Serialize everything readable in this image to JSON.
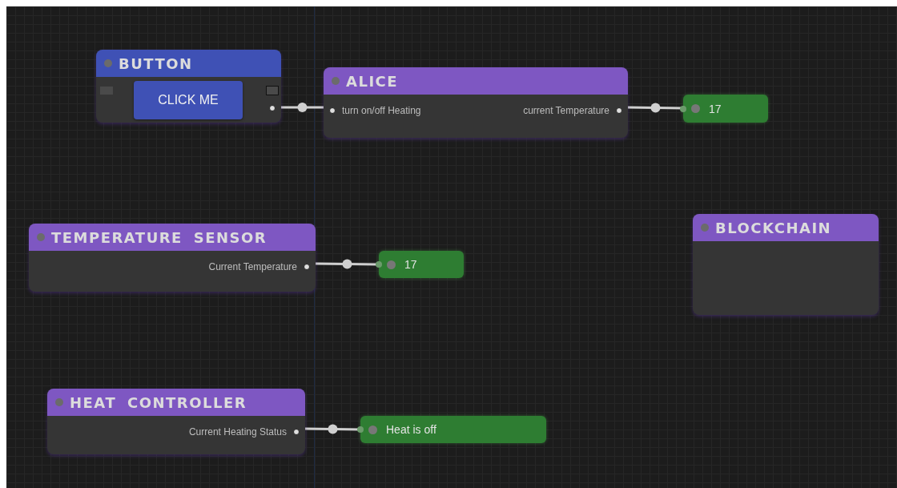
{
  "canvas": {
    "nodes": [
      {
        "kind": "button",
        "title": "BUTTON",
        "color": "#3f51b5",
        "button_label": "CLICK ME",
        "output_connected": true
      },
      {
        "kind": "node",
        "title": "ALICE",
        "color": "#7e57c2",
        "inputs": [
          "turn on/off Heating"
        ],
        "outputs": [
          {
            "label": "current Temperature",
            "connected": true
          }
        ]
      },
      {
        "kind": "display",
        "value": "17"
      },
      {
        "kind": "node",
        "title": "TEMPERATURE SENSOR",
        "color": "#7e57c2",
        "outputs": [
          {
            "label": "Current Temperature",
            "connected": true
          }
        ]
      },
      {
        "kind": "display",
        "value": "17"
      },
      {
        "kind": "node",
        "title": "BLOCKCHAIN",
        "color": "#7e57c2"
      },
      {
        "kind": "node",
        "title": "HEAT CONTROLLER",
        "color": "#7e57c2",
        "outputs": [
          {
            "label": "Current Heating Status",
            "connected": true
          }
        ]
      },
      {
        "kind": "display",
        "value": "Heat is off"
      }
    ]
  }
}
